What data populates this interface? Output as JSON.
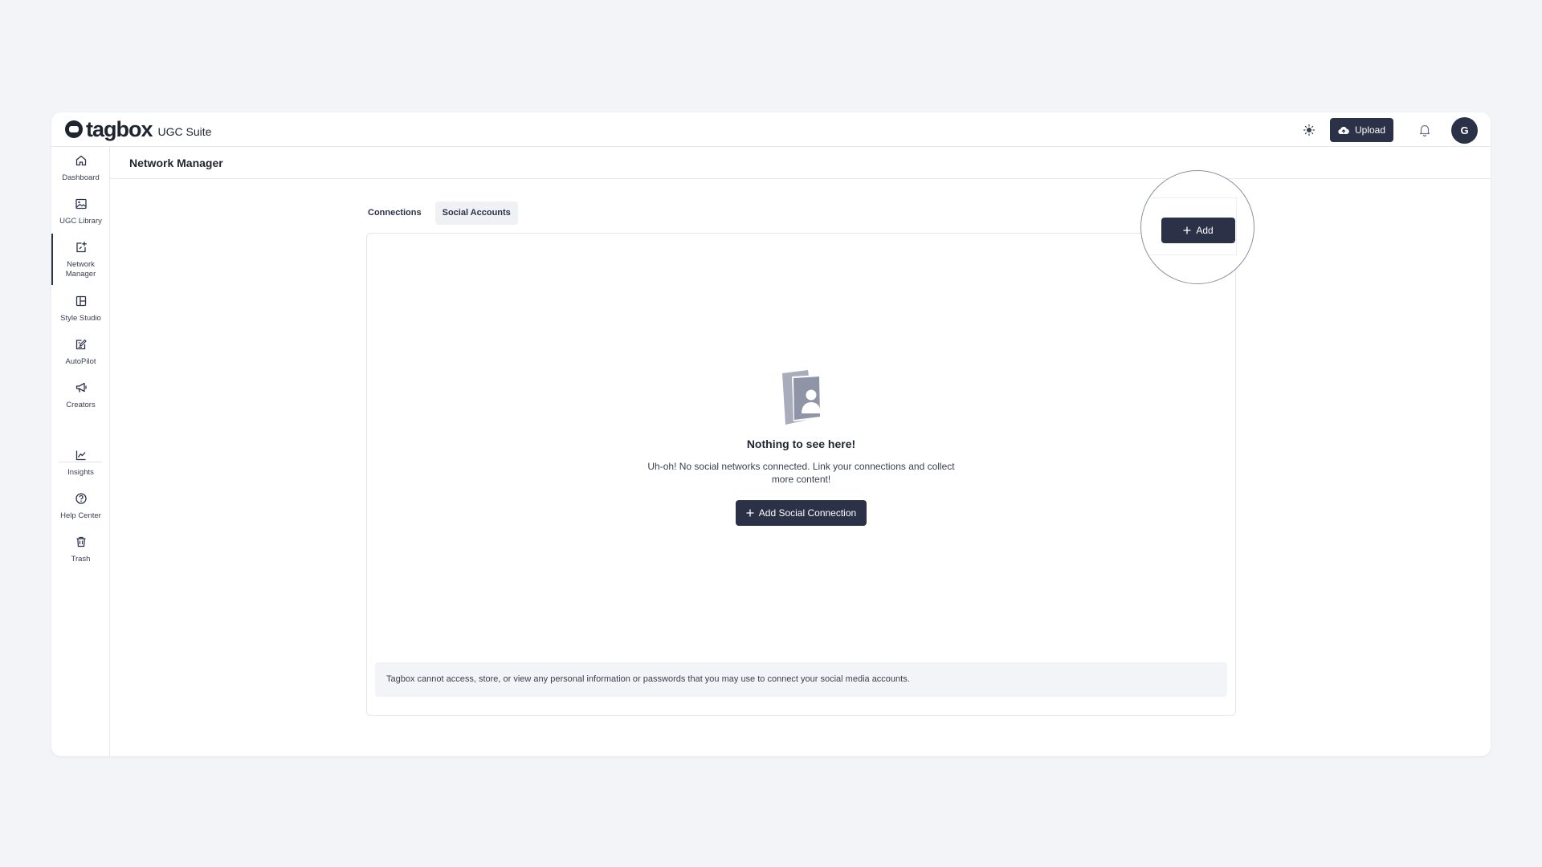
{
  "brand": {
    "name": "tagbox",
    "suite": "UGC Suite"
  },
  "topbar": {
    "theme_icon": "sun-icon",
    "upload_label": "Upload",
    "notification_icon": "bell-icon",
    "avatar_initial": "G"
  },
  "sidebar": {
    "items": [
      {
        "label": "Dashboard",
        "icon": "home-icon"
      },
      {
        "label": "UGC Library",
        "icon": "image-icon"
      },
      {
        "label": "Network Manager",
        "icon": "network-add-icon",
        "active": true
      },
      {
        "label": "Style Studio",
        "icon": "layout-icon"
      },
      {
        "label": "AutoPilot",
        "icon": "edit-icon"
      },
      {
        "label": "Creators",
        "icon": "megaphone-icon"
      },
      {
        "label": "Insights",
        "icon": "chart-icon"
      },
      {
        "label": "Help Center",
        "icon": "help-icon"
      },
      {
        "label": "Trash",
        "icon": "trash-icon"
      }
    ]
  },
  "page": {
    "title": "Network Manager"
  },
  "tabs": [
    {
      "label": "Connections",
      "selected": false
    },
    {
      "label": "Social Accounts",
      "selected": true
    }
  ],
  "spotlight": {
    "add_label": "Add"
  },
  "empty_state": {
    "title": "Nothing to see here!",
    "description": "Uh-oh! No social networks connected. Link your connections and collect more content!",
    "button_label": "Add Social Connection"
  },
  "disclaimer": "Tagbox cannot access, store, or view any personal information or passwords that you may use to connect your social media accounts.",
  "colors": {
    "primary": "#2b3147",
    "background": "#f3f4f8"
  }
}
